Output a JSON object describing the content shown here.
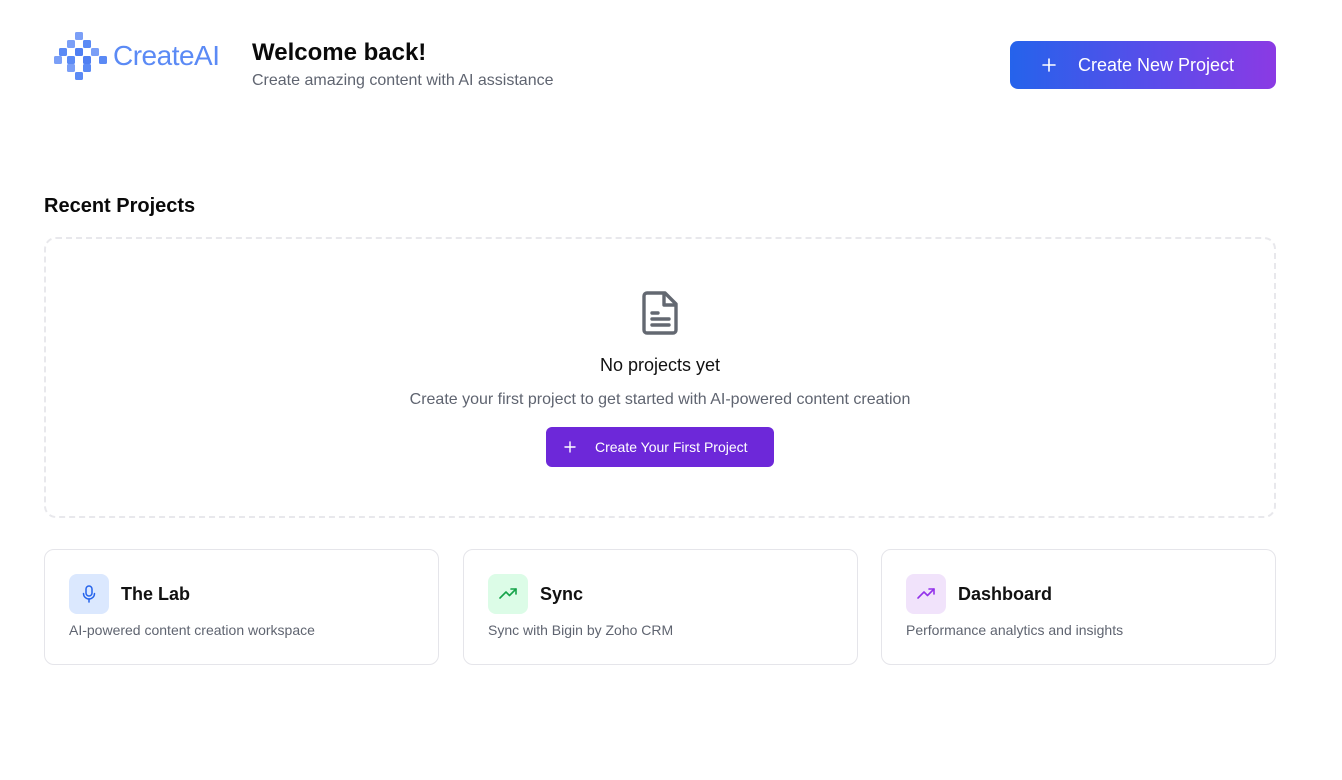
{
  "brand": {
    "name": "CreateAI",
    "color": "#5b8af5"
  },
  "header": {
    "title": "Welcome back!",
    "subtitle": "Create amazing content with AI assistance",
    "new_project_label": "Create New Project"
  },
  "recent": {
    "title": "Recent Projects",
    "empty_title": "No projects yet",
    "empty_subtitle": "Create your first project to get started with AI-powered content creation",
    "first_project_label": "Create Your First Project"
  },
  "cards": [
    {
      "title": "The Lab",
      "description": "AI-powered content creation workspace",
      "icon": "microphone-icon",
      "icon_bg": "#dbe8fe",
      "icon_color": "#2563eb"
    },
    {
      "title": "Sync",
      "description": "Sync with Bigin by Zoho CRM",
      "icon": "trending-up-icon",
      "icon_bg": "#dcfce7",
      "icon_color": "#16a34a"
    },
    {
      "title": "Dashboard",
      "description": "Performance analytics and insights",
      "icon": "trending-up-icon",
      "icon_bg": "#f1e3fb",
      "icon_color": "#9333ea"
    }
  ]
}
